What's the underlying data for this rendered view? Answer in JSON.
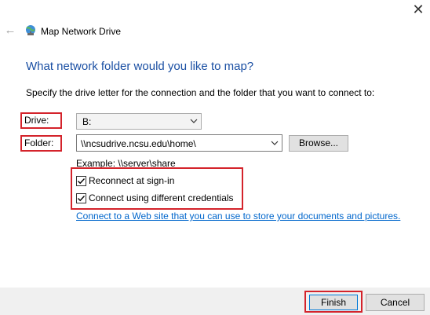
{
  "window": {
    "close_glyph": "✕",
    "back_glyph": "←",
    "app_icon": "network-drive-icon",
    "title": "Map Network Drive"
  },
  "main": {
    "heading": "What network folder would you like to map?",
    "instructions": "Specify the drive letter for the connection and the folder that you want to connect to:",
    "drive": {
      "label": "Drive:",
      "value": "B:"
    },
    "folder": {
      "label": "Folder:",
      "value": "\\\\ncsudrive.ncsu.edu\\home\\"
    },
    "browse_label": "Browse...",
    "example": "Example: \\\\server\\share",
    "reconnect": {
      "label": "Reconnect at sign-in",
      "checked": true
    },
    "different_credentials": {
      "label": "Connect using different credentials",
      "checked": true
    },
    "link": "Connect to a Web site that you can use to store your documents and pictures."
  },
  "footer": {
    "finish_label": "Finish",
    "cancel_label": "Cancel"
  },
  "colors": {
    "heading": "#1a4fa3",
    "link": "#0066cc",
    "highlight": "#d4232b",
    "focus": "#0078d7"
  }
}
